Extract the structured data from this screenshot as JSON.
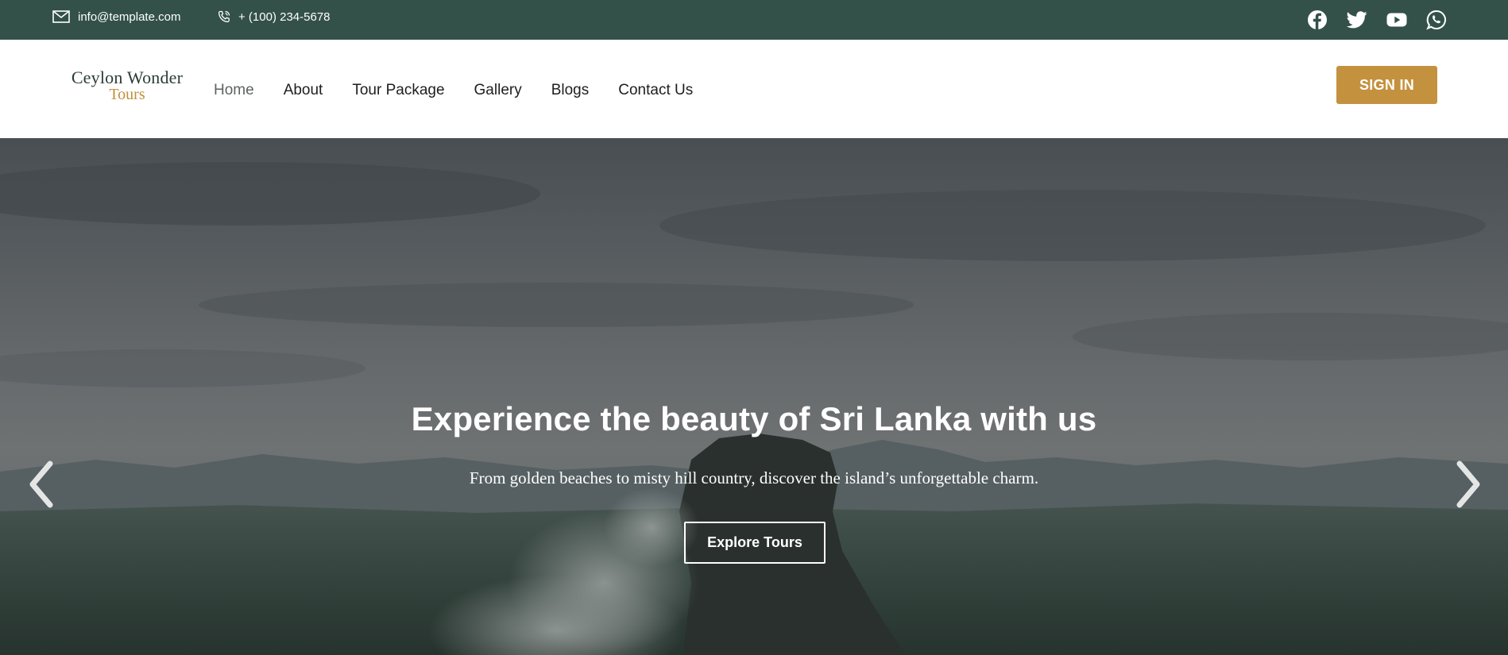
{
  "topbar": {
    "email": "info@template.com",
    "phone": "+ (100) 234-5678",
    "social": [
      "facebook-icon",
      "twitter-icon",
      "youtube-icon",
      "whatsapp-icon"
    ]
  },
  "header": {
    "logo_line1": "Ceylon Wonder",
    "logo_line2": "Tours",
    "nav": [
      {
        "label": "Home"
      },
      {
        "label": "About"
      },
      {
        "label": "Tour Package"
      },
      {
        "label": "Gallery"
      },
      {
        "label": "Blogs"
      },
      {
        "label": "Contact Us"
      }
    ],
    "signin_label": "SIGN IN"
  },
  "hero": {
    "title": "Experience the beauty of Sri Lanka with us",
    "subtitle": "From golden beaches to misty hill country, discover the island’s unforgettable charm.",
    "cta_label": "Explore Tours",
    "prev_icon": "chevron-left-icon",
    "next_icon": "chevron-right-icon"
  },
  "colors": {
    "topbar_bg": "#335148",
    "accent": "#c4913e",
    "logo_dark": "#2b3d37",
    "logo_gold": "#c28f3a",
    "nav_active": "#5d6362",
    "nav_text": "#1e1e1e"
  }
}
